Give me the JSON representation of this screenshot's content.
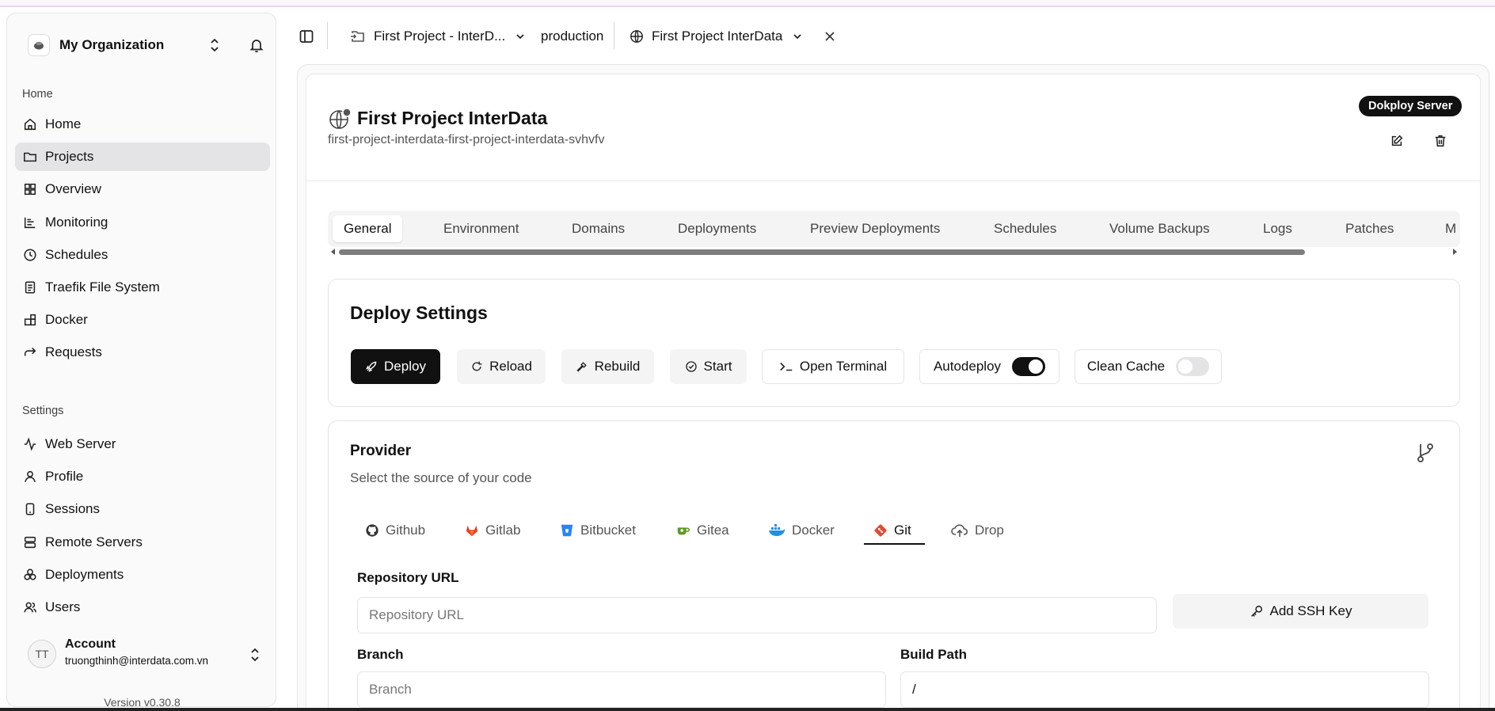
{
  "sidebar": {
    "org_name": "My Organization",
    "home_section": "Home",
    "settings_section": "Settings",
    "home_items": [
      {
        "label": "Home",
        "icon": "home-icon"
      },
      {
        "label": "Projects",
        "icon": "folder-icon",
        "active": true
      },
      {
        "label": "Overview",
        "icon": "grid-icon"
      },
      {
        "label": "Monitoring",
        "icon": "chart-icon"
      },
      {
        "label": "Schedules",
        "icon": "clock-icon"
      },
      {
        "label": "Traefik File System",
        "icon": "file-icon"
      },
      {
        "label": "Docker",
        "icon": "blocks-icon"
      },
      {
        "label": "Requests",
        "icon": "forward-icon"
      }
    ],
    "settings_items": [
      {
        "label": "Web Server",
        "icon": "activity-icon"
      },
      {
        "label": "Profile",
        "icon": "user-icon"
      },
      {
        "label": "Sessions",
        "icon": "phone-icon"
      },
      {
        "label": "Remote Servers",
        "icon": "server-icon"
      },
      {
        "label": "Deployments",
        "icon": "boxes-icon"
      },
      {
        "label": "Users",
        "icon": "users-icon"
      }
    ],
    "account": {
      "initials": "TT",
      "name": "Account",
      "email": "truongthinh@interdata.com.vn"
    },
    "version": "Version v0.30.8"
  },
  "topbar": {
    "project": "First Project - InterD...",
    "environment": "production",
    "service": "First Project InterData"
  },
  "header": {
    "title": "First Project InterData",
    "app_name": "first-project-interdata-first-project-interdata-svhvfv",
    "server_badge": "Dokploy Server"
  },
  "tabs": [
    "General",
    "Environment",
    "Domains",
    "Deployments",
    "Preview Deployments",
    "Schedules",
    "Volume Backups",
    "Logs",
    "Patches",
    "M"
  ],
  "deploy_settings": {
    "title": "Deploy Settings",
    "deploy": "Deploy",
    "reload": "Reload",
    "rebuild": "Rebuild",
    "start": "Start",
    "open_terminal": "Open Terminal",
    "autodeploy": "Autodeploy",
    "autodeploy_on": true,
    "clean_cache": "Clean Cache",
    "clean_cache_on": false
  },
  "provider": {
    "title": "Provider",
    "subtitle": "Select the source of your code",
    "tabs": [
      "Github",
      "Gitlab",
      "Bitbucket",
      "Gitea",
      "Docker",
      "Git",
      "Drop"
    ],
    "active_tab": "Git",
    "repo_label": "Repository URL",
    "repo_placeholder": "Repository URL",
    "add_ssh_key": "Add SSH Key",
    "branch_label": "Branch",
    "branch_placeholder": "Branch",
    "build_path_label": "Build Path",
    "build_path_value": "/"
  },
  "colors": {
    "accent": "#111111",
    "gitlab": "#e24329",
    "bitbucket": "#2684ff",
    "gitea": "#609926",
    "docker": "#1d91e6",
    "git": "#e24b33"
  }
}
